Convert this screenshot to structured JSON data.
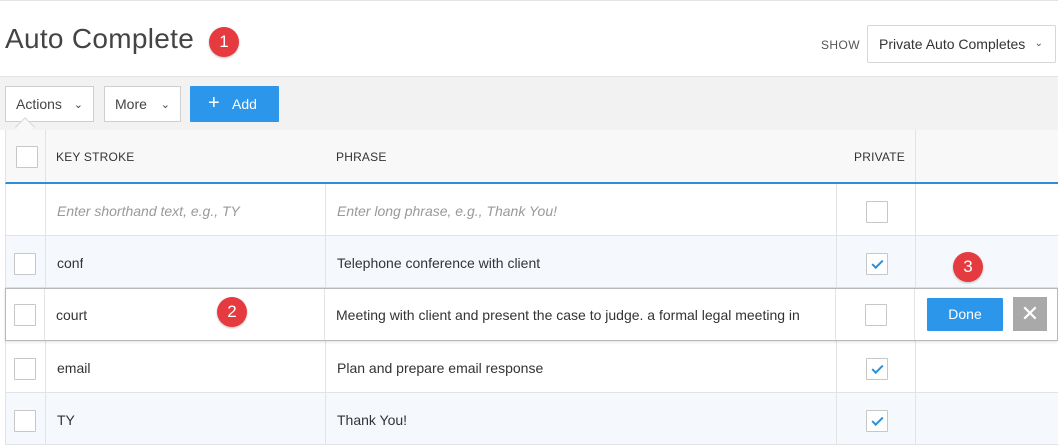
{
  "header": {
    "title": "Auto Complete",
    "show_label": "SHOW",
    "show_value": "Private Auto Completes"
  },
  "toolbar": {
    "actions_label": "Actions",
    "more_label": "More",
    "add_label": "Add"
  },
  "annotations": [
    "1",
    "2",
    "3"
  ],
  "table": {
    "columns": [
      "KEY STROKE",
      "PHRASE",
      "PRIVATE"
    ],
    "new_row": {
      "keystroke_placeholder": "Enter shorthand text, e.g., TY",
      "phrase_placeholder": "Enter long phrase, e.g., Thank You!"
    },
    "rows": [
      {
        "keystroke": "conf",
        "phrase": "Telephone conference with client",
        "private": true
      },
      {
        "keystroke": "court",
        "phrase": "Meeting with client and present the case to judge. a formal legal meeting in",
        "private": false
      },
      {
        "keystroke": "email",
        "phrase": "Plan and prepare email response",
        "private": true
      },
      {
        "keystroke": "TY",
        "phrase": "Thank You!",
        "private": true
      }
    ],
    "done_label": "Done"
  },
  "colors": {
    "accent": "#2b96ea",
    "badge": "#e53a3f"
  }
}
